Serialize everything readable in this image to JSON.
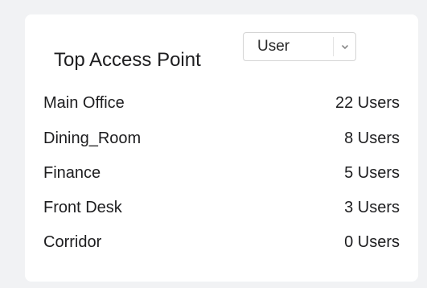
{
  "widget": {
    "title": "Top Access Point",
    "filter": {
      "selected": "User"
    },
    "rows": [
      {
        "name": "Main Office",
        "count": "22 Users"
      },
      {
        "name": "Dining_Room",
        "count": "8 Users"
      },
      {
        "name": "Finance",
        "count": "5 Users"
      },
      {
        "name": "Front Desk",
        "count": "3 Users"
      },
      {
        "name": "Corridor",
        "count": "0 Users"
      }
    ]
  }
}
